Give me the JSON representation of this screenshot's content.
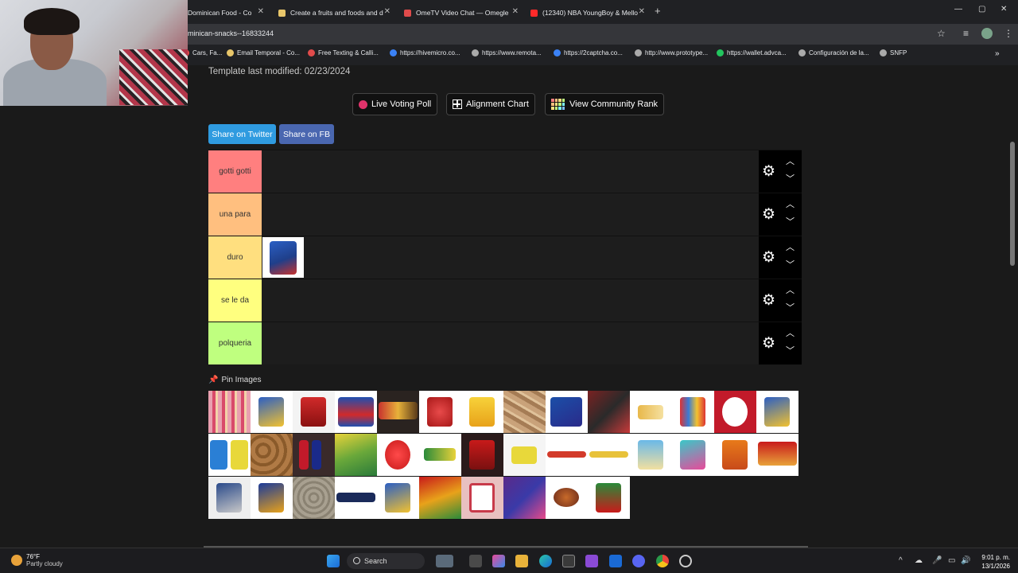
{
  "browser": {
    "tabs": [
      {
        "label": "Dominican Food - Co",
        "color": "#ffffff"
      },
      {
        "label": "Create a fruits and foods and d",
        "color": "#e8c66a"
      },
      {
        "label": "OmeTV Video Chat — Omegle",
        "color": "#e04b4b"
      },
      {
        "label": "(12340) NBA YoungBoy & Mello",
        "color": "#ff2a2a"
      }
    ],
    "url": "minican-snacks--16833244",
    "bookmarks": [
      {
        "label": "Cars, Fa...",
        "color": "#e04b4b"
      },
      {
        "label": "Email Temporal - Co...",
        "color": "#e8c66a"
      },
      {
        "label": "Free Texting & Calli...",
        "color": "#e04b4b"
      },
      {
        "label": "https://hivemicro.co...",
        "color": "#3b82f6"
      },
      {
        "label": "https://www.remota...",
        "color": "#aaaaaa"
      },
      {
        "label": "https://2captcha.co...",
        "color": "#3b82f6"
      },
      {
        "label": "http://www.prototype...",
        "color": "#aaaaaa"
      },
      {
        "label": "https://wallet.advca...",
        "color": "#22c55e"
      },
      {
        "label": "Configuración de la...",
        "color": "#aaaaaa"
      },
      {
        "label": "SNFP",
        "color": "#aaaaaa"
      }
    ]
  },
  "page": {
    "modified": "Template last modified: 02/23/2024",
    "buttons": {
      "live_poll": "Live Voting Poll",
      "alignment": "Alignment Chart",
      "community": "View Community Rank"
    },
    "share": {
      "twitter": "Share on Twitter",
      "fb": "Share on FB",
      "twitter_color": "#2f9be0",
      "fb_color": "#4a67b0"
    },
    "tiers": [
      {
        "label": "gotti gotti",
        "color": "#ff7f7f"
      },
      {
        "label": "una para",
        "color": "#ffbf7f"
      },
      {
        "label": "duro",
        "color": "#ffdf7f"
      },
      {
        "label": "se le da",
        "color": "#ffff7f"
      },
      {
        "label": "polqueria",
        "color": "#bfff7f"
      }
    ],
    "pin_label": "Pin Images"
  },
  "taskbar": {
    "temp": "76°F",
    "weather": "Partly cloudy",
    "search": "Search",
    "time": "9:01 p. m.",
    "date": "13/1/2026"
  }
}
